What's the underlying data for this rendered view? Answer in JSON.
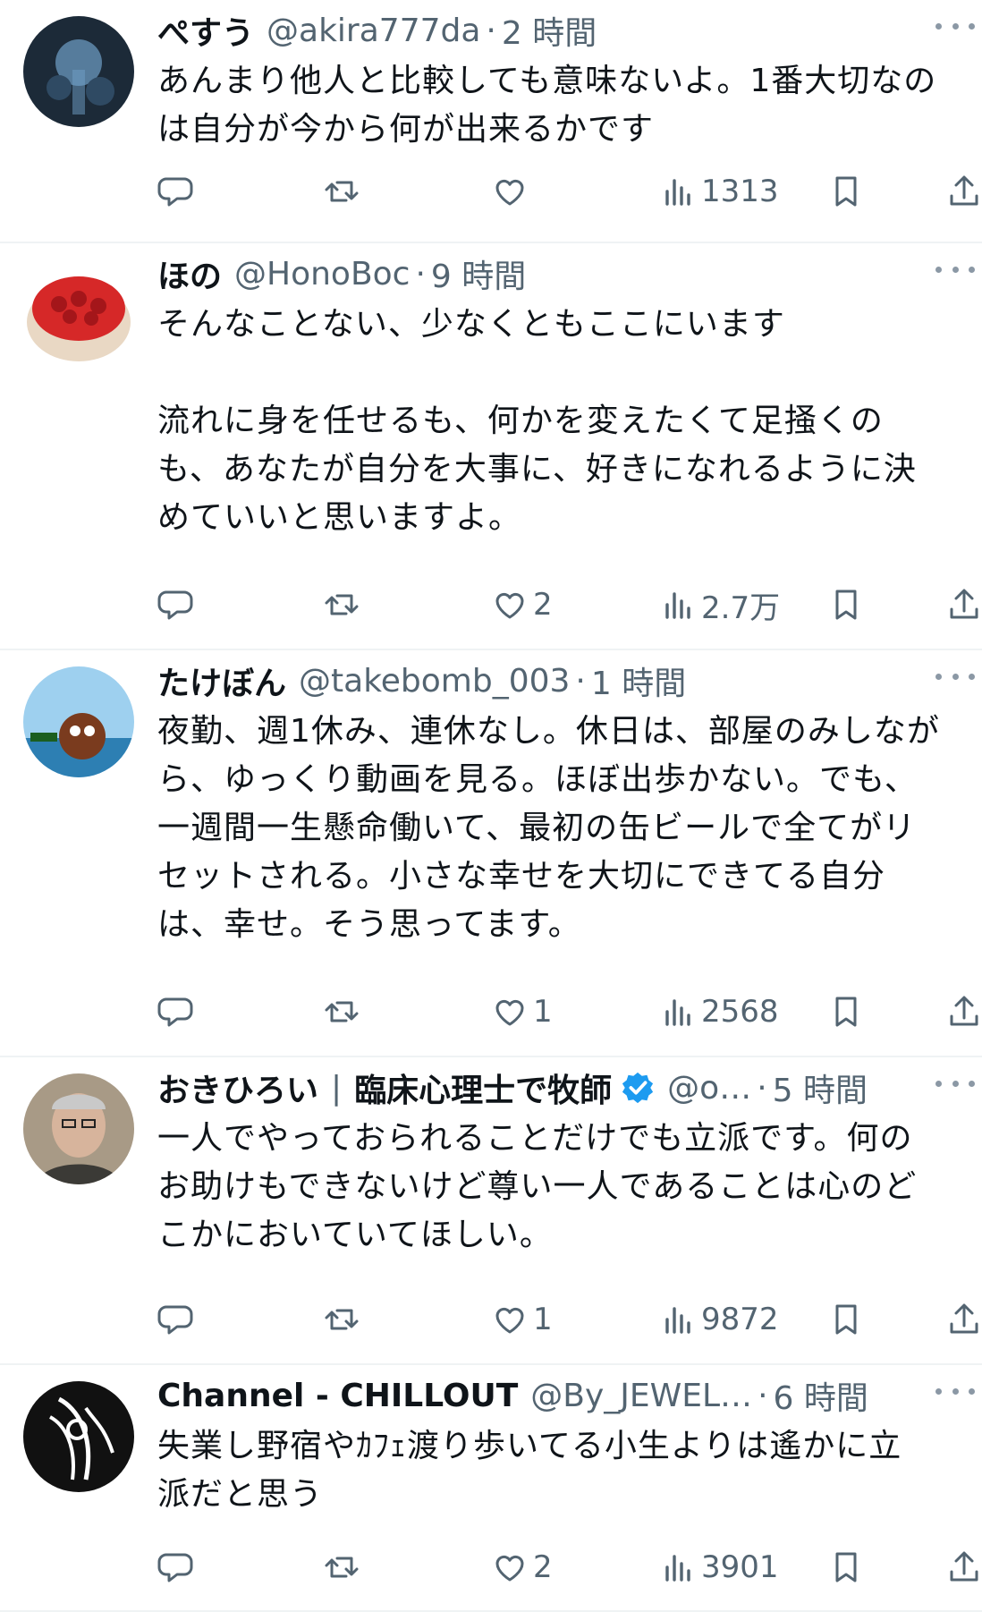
{
  "tweets": [
    {
      "name": "ぺすう",
      "handle": "@akira777da",
      "time": "2 時間",
      "text": "あんまり他人と比較しても意味ないよ。1番大切なの\nは自分が今から何が出来るかです",
      "replies": "",
      "retweets": "",
      "likes": "",
      "views": "1313",
      "avatar_colors": [
        "#1c2a38",
        "#6fa0c8"
      ]
    },
    {
      "name": "ほの",
      "handle": "@HonoBoc",
      "time": "9 時間",
      "text": "そんなことない、少なくともここにいます\n\n流れに身を任せるも、何かを変えたくて足掻くの\nも、あなたが自分を大事に、好きになれるように決\nめていいと思いますよ。",
      "replies": "",
      "retweets": "",
      "likes": "2",
      "views": "2.7万",
      "avatar_colors": [
        "#e9d8c4",
        "#d62828"
      ]
    },
    {
      "name": "たけぼん",
      "handle": "@takebomb_003",
      "time": "1 時間",
      "text": "夜勤、週1休み、連休なし。休日は、部屋のみしなが\nら、ゆっくり動画を見る。ほぼ出歩かない。でも、\n一週間一生懸命働いて、最初の缶ビールで全てがリ\nセットされる。小さな幸せを大切にできてる自分\nは、幸せ。そう思ってます。",
      "replies": "",
      "retweets": "",
      "likes": "1",
      "views": "2568",
      "avatar_colors": [
        "#9ed0ef",
        "#7a3b1e"
      ]
    },
    {
      "name": "おきひろい",
      "title": "臨床心理士で牧師",
      "verified": true,
      "handle": "@o…",
      "time": "5 時間",
      "text": "一人でやっておられることだけでも立派です。何の\nお助けもできないけど尊い一人であることは心のど\nこかにおいていてほしい。",
      "replies": "",
      "retweets": "",
      "likes": "1",
      "views": "9872",
      "avatar_colors": [
        "#a89a86",
        "#3b3a36"
      ]
    },
    {
      "name": "Channel - CHILLOUT",
      "handle": "@By_JEWEL…",
      "time": "6 時間",
      "text": "失業し野宿やｶﾌｪ渡り歩いてる小生よりは遙かに立\n派だと思う",
      "replies": "",
      "retweets": "",
      "likes": "2",
      "views": "3901",
      "avatar_colors": [
        "#111111",
        "#ffffff"
      ]
    }
  ],
  "colors": {
    "text": "#0f1419",
    "muted": "#536471",
    "divider": "#eff3f4",
    "verified": "#1d9bf0"
  },
  "icons": [
    "reply-icon",
    "retweet-icon",
    "like-icon",
    "views-icon",
    "bookmark-icon",
    "share-icon",
    "more-icon",
    "verified-badge-icon"
  ]
}
